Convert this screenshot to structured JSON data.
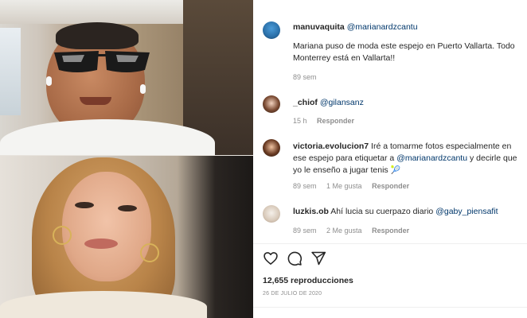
{
  "post": {
    "author": "manuvaquita",
    "author_mention": "@marianardzcantu",
    "caption": "Mariana puso de moda este espejo en Puerto Vallarta. Todo Monterrey está en Vallarta!!",
    "caption_age": "89 sem"
  },
  "comments": [
    {
      "user": "_chiof",
      "mention": "@gilansanz",
      "text_before": "",
      "text_after": "",
      "age": "15 h",
      "likes": "",
      "reply": "Responder"
    },
    {
      "user": "victoria.evolucion7",
      "mention": "@marianardzcantu",
      "text_before": "Iré a tomarme fotos especialmente en ese espejo para etiquetar a",
      "text_after": "y decirle que yo le enseño a jugar tenis",
      "emoji": "🎾",
      "age": "89 sem",
      "likes": "1 Me gusta",
      "reply": "Responder"
    },
    {
      "user": "luzkis.ob",
      "mention": "@gaby_piensafit",
      "text_before": "Ahí lucia su cuerpazo diario",
      "text_after": "",
      "age": "89 sem",
      "likes": "2 Me gusta",
      "reply": "Responder"
    }
  ],
  "actions": {
    "like_icon": "heart-icon",
    "comment_icon": "comment-icon",
    "share_icon": "send-icon"
  },
  "stats": {
    "views": "12,655 reproducciones",
    "date": "26 DE JULIO DE 2020"
  },
  "colors": {
    "mention": "#00376b",
    "meta": "#8e8e8e",
    "text": "#262626"
  }
}
